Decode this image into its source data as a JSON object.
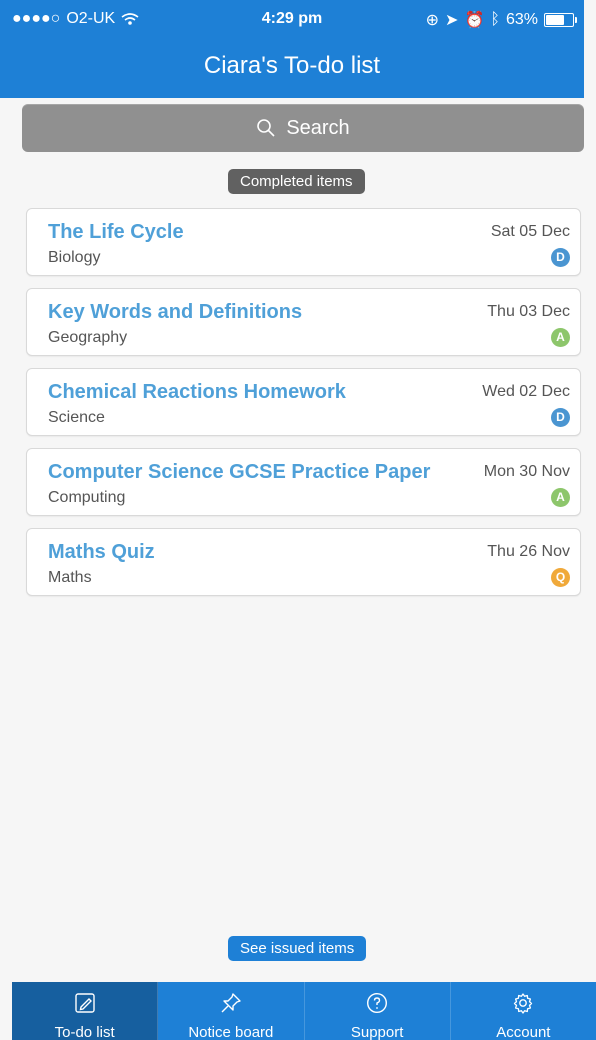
{
  "status_bar": {
    "carrier": "O2-UK",
    "time": "4:29 pm",
    "battery": "63%",
    "battery_level": 0.63
  },
  "header": {
    "title": "Ciara's To-do list"
  },
  "search": {
    "placeholder": "Search"
  },
  "filters": {
    "completed_label": "Completed items",
    "issued_label": "See issued items"
  },
  "items": [
    {
      "title": "The Life Cycle",
      "subject": "Biology",
      "date": "Sat 05 Dec",
      "badge": "D",
      "badge_color": "#4a95d1"
    },
    {
      "title": "Key Words and Definitions",
      "subject": "Geography",
      "date": "Thu 03 Dec",
      "badge": "A",
      "badge_color": "#8dc66b"
    },
    {
      "title": "Chemical Reactions Homework",
      "subject": "Science",
      "date": "Wed 02 Dec",
      "badge": "D",
      "badge_color": "#4a95d1"
    },
    {
      "title": "Computer Science GCSE Practice Paper",
      "subject": "Computing",
      "date": "Mon 30 Nov",
      "badge": "A",
      "badge_color": "#8dc66b"
    },
    {
      "title": "Maths Quiz",
      "subject": "Maths",
      "date": "Thu 26 Nov",
      "badge": "Q",
      "badge_color": "#f0a93a"
    }
  ],
  "tabs": [
    {
      "label": "To-do list",
      "icon": "edit-icon"
    },
    {
      "label": "Notice board",
      "icon": "pin-icon"
    },
    {
      "label": "Support",
      "icon": "help-icon"
    },
    {
      "label": "Account",
      "icon": "gear-icon"
    }
  ],
  "colors": {
    "primary": "#1e80d6",
    "active_tab": "#165f9f",
    "title_text": "#4fa0d8"
  }
}
